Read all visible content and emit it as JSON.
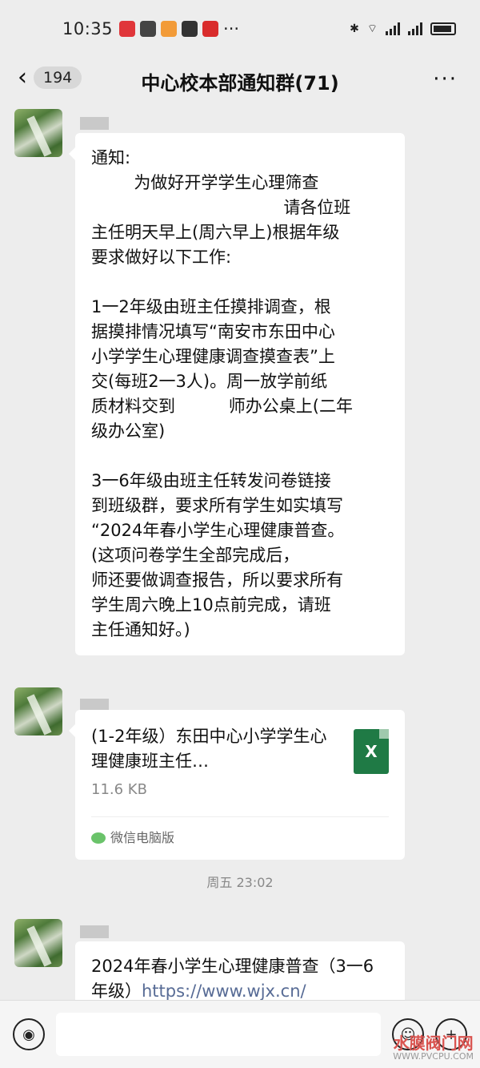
{
  "status_bar": {
    "time": "10:35",
    "more": "···"
  },
  "header": {
    "back_count": "194",
    "title": "中心校本部通知群(71)",
    "more": "···"
  },
  "messages": {
    "notice": {
      "lines": [
        "通知:",
        "        为做好开学学生心理筛查",
        "                                    请各位班",
        "主任明天早上(周六早上)根据年级",
        "要求做好以下工作:",
        "",
        "1一2年级由班主任摸排调查，根",
        "据摸排情况填写“南安市东田中心",
        "小学学生心理健康调查摸查表”上",
        "交(每班2一3人)。周一放学前纸",
        "质材料交到          师办公桌上(二年",
        "级办公室)",
        "",
        "3一6年级由班主任转发问卷链接",
        "到班级群，要求所有学生如实填写",
        "“2024年春小学生心理健康普查。",
        "(这项问卷学生全部完成后，",
        "师还要做调查报告，所以要求所有",
        "学生周六晚上10点前完成，请班",
        "主任通知好。)"
      ]
    },
    "file": {
      "name": "(1-2年级）东田中心小学学生心理健康班主任…",
      "size": "11.6 KB",
      "icon_letter": "X",
      "source": "微信电脑版"
    },
    "timestamp": "周五 23:02",
    "link_msg": {
      "text": "2024年春小学生心理健康普查（3一6年级）",
      "link": "https://www.wjx.cn/"
    }
  },
  "watermark": {
    "title": "水膜阀门网",
    "url": "WWW.PVCPU.COM"
  },
  "colors": {
    "background": "#ededed",
    "bubble": "#ffffff",
    "link": "#576b95",
    "excel": "#1f7a45"
  }
}
